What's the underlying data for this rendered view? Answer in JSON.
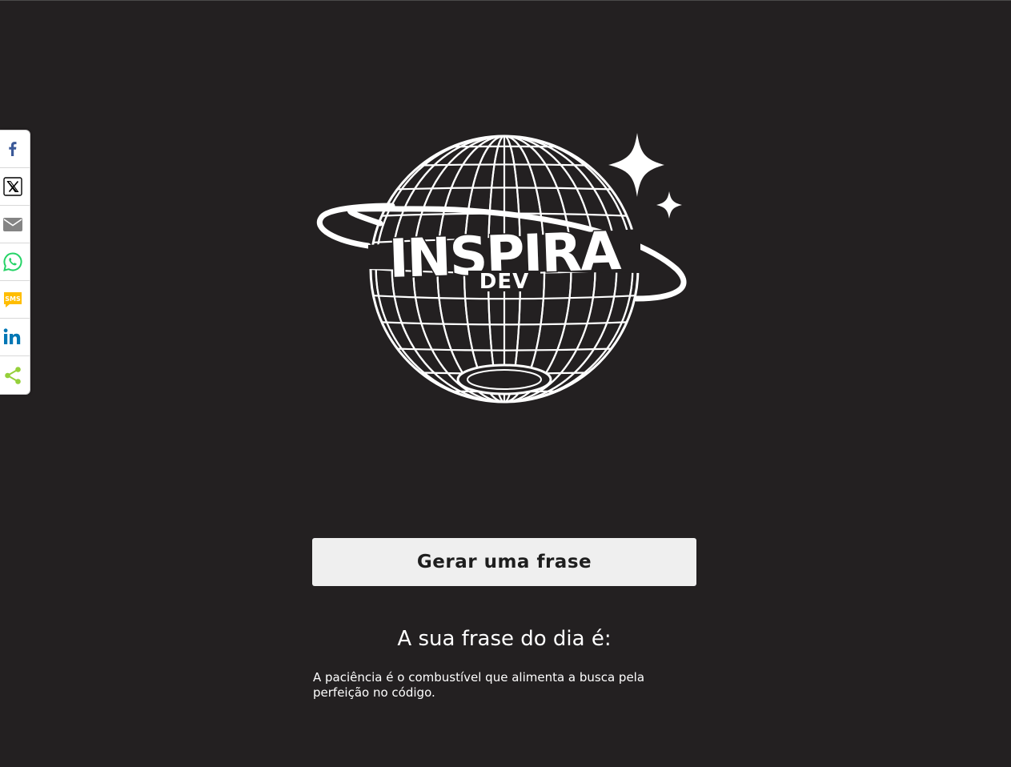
{
  "share_bar": {
    "buttons": [
      {
        "name": "facebook",
        "icon": "facebook-icon",
        "color": "#3b5998"
      },
      {
        "name": "x",
        "icon": "x-twitter-icon",
        "color": "#000000"
      },
      {
        "name": "email",
        "icon": "email-icon",
        "color": "#848484"
      },
      {
        "name": "whatsapp",
        "icon": "whatsapp-icon",
        "color": "#25d366"
      },
      {
        "name": "sms",
        "icon": "sms-icon",
        "color": "#ffbd00",
        "label": "SMS"
      },
      {
        "name": "linkedin",
        "icon": "linkedin-icon",
        "color": "#0077b5"
      },
      {
        "name": "share",
        "icon": "share-icon",
        "color": "#95d03a"
      }
    ]
  },
  "logo": {
    "title": "INSPIRA",
    "subtitle": "DEV"
  },
  "main": {
    "button_label": "Gerar uma frase",
    "heading": "A sua frase do dia é:",
    "quote": "A paciência é o combustível que alimenta a busca pela perfeição no código."
  },
  "colors": {
    "background": "#232021",
    "button_bg": "#efefef",
    "text": "#ffffff"
  }
}
